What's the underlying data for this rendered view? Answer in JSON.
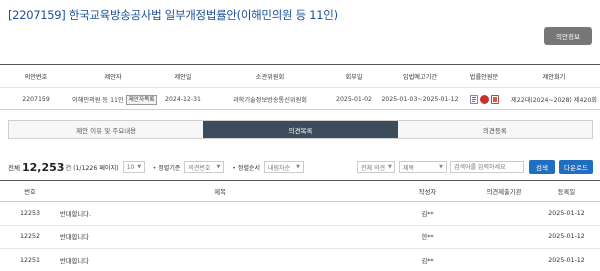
{
  "page": {
    "title": "[2207159] 한국교육방송공사법 일부개정법률안(이해민의원 등 11인)",
    "info_button": "의안정보"
  },
  "info": {
    "headers": [
      "의안번호",
      "제안자",
      "제안일",
      "소관위원회",
      "회부일",
      "입법예고기간",
      "법률안원문",
      "제안회기"
    ],
    "bill_no": "2207159",
    "proposer": "이해민의원 등 11인",
    "proposer_badge": "제안자목록",
    "proposed_date": "2024-12-31",
    "committee": "과학기술정보방송통신위원회",
    "referral_date": "2025-01-02",
    "notice_period": "2025-01-03~2025-01-12",
    "session": "제22대(2024~2028) 제420회",
    "law_icons": [
      "hwp-icon",
      "pdf-icon",
      "doc-icon"
    ]
  },
  "tabs": [
    {
      "label": "제안 이유 및 주요내용",
      "active": false
    },
    {
      "label": "의견목록",
      "active": true
    },
    {
      "label": "의견등록",
      "active": false
    }
  ],
  "toolbar": {
    "total_prefix": "전체",
    "total_count": "12,253",
    "total_suffix": "건 (1/1226 페이지)",
    "page_size": "10",
    "sort_label": "정렬기준",
    "sort_value": "의견번호",
    "order_label": "정렬순서",
    "order_value": "내림차순",
    "scope_value": "전체 의견",
    "field_value": "제목",
    "search_placeholder": "검색어를 입력하세요",
    "search_button": "검색",
    "download_button": "다운로드"
  },
  "list": {
    "headers": {
      "no": "번호",
      "title": "제목",
      "author": "작성자",
      "org": "의견제출기관",
      "date": "등록일"
    },
    "rows": [
      {
        "no": "12253",
        "title": "반대합니다.",
        "author": "김**",
        "org": "",
        "date": "2025-01-12"
      },
      {
        "no": "12252",
        "title": "반대합니다",
        "author": "한**",
        "org": "",
        "date": "2025-01-12"
      },
      {
        "no": "12251",
        "title": "반대합니다",
        "author": "김**",
        "org": "",
        "date": "2025-01-12"
      }
    ]
  },
  "colors": {
    "title": "#1d4f9c",
    "active_tab": "#3d4c5d",
    "primary_button": "#1f6ec0",
    "info_button": "#777777"
  }
}
